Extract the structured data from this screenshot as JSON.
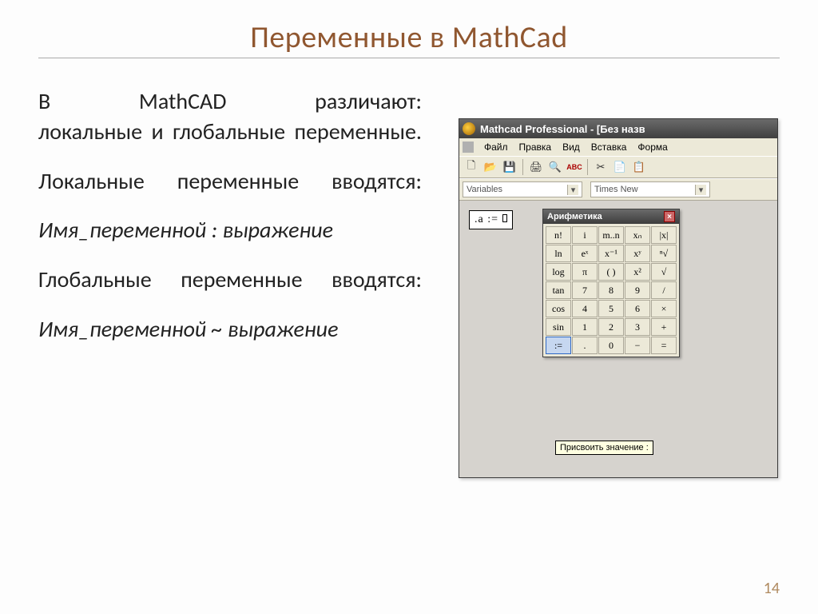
{
  "slide": {
    "title": "Переменные в MathCad",
    "page_number": "14",
    "paragraphs": {
      "p1a": "В MathCAD различают:",
      "p1b": "локальные и глобальные переменные.",
      "p2": "Локальные переменные вводятся:",
      "p3": "Имя_переменной : выражение",
      "p4": "Глобальные переменные вводятся:",
      "p5": "Имя_переменной ~ выражение"
    }
  },
  "app": {
    "title": "Mathcad Professional - [Без назв",
    "menu": [
      "Файл",
      "Правка",
      "Вид",
      "Вставка",
      "Форма"
    ],
    "toolbar_icons": [
      "new",
      "open",
      "save",
      "print",
      "preview",
      "spell",
      "cut",
      "copy",
      "paste"
    ],
    "combo_style": "Variables",
    "combo_font": "Times New",
    "math_expr_prefix": ".a :=",
    "palette": {
      "title": "Арифметика",
      "rows": [
        [
          "n!",
          "i",
          "m..n",
          "xₙ",
          "|x|"
        ],
        [
          "ln",
          "eˣ",
          "x⁻¹",
          "xʸ",
          "ⁿ√"
        ],
        [
          "log",
          "π",
          "( )",
          "x²",
          "√"
        ],
        [
          "tan",
          "7",
          "8",
          "9",
          "/"
        ],
        [
          "cos",
          "4",
          "5",
          "6",
          "×"
        ],
        [
          "sin",
          "1",
          "2",
          "3",
          "+"
        ],
        [
          ":=",
          ".",
          "0",
          "−",
          "="
        ]
      ]
    },
    "tooltip": "Присвоить значение :"
  }
}
